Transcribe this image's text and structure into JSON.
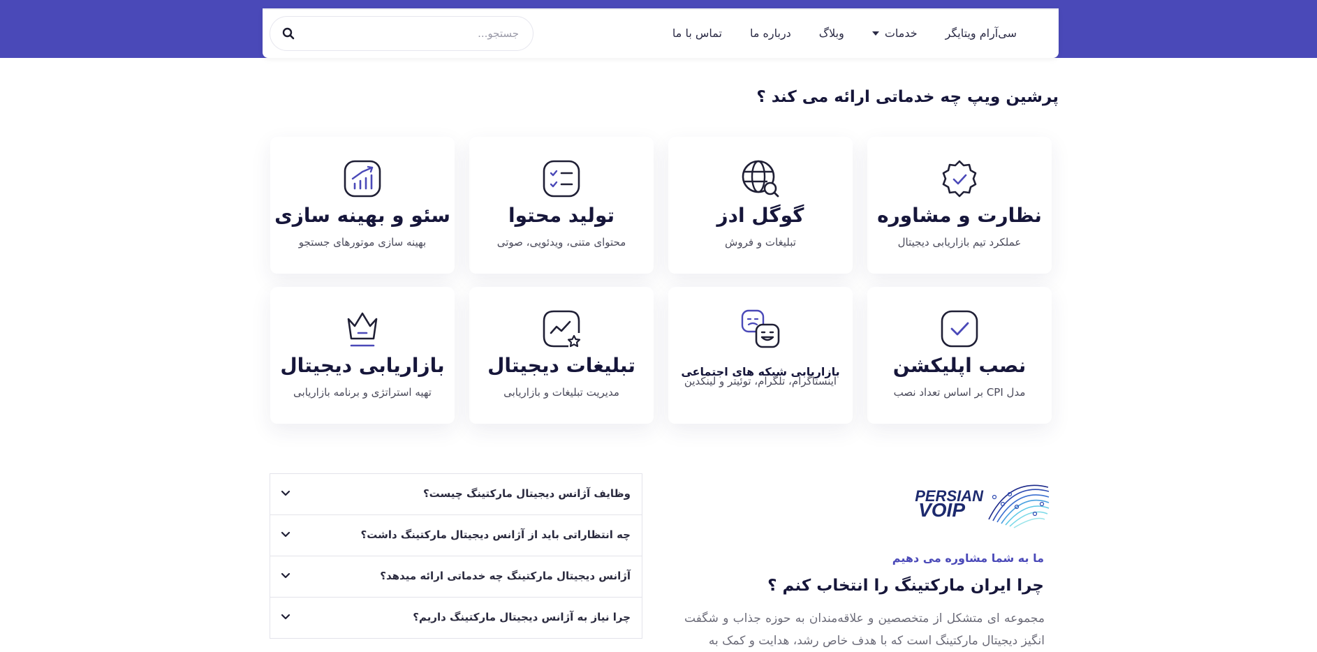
{
  "colors": {
    "brand": "#4a49b8",
    "heading": "#16163a",
    "text": "#4a4a5a"
  },
  "nav": {
    "items": [
      {
        "label": "سی‌آرام ویتایگر",
        "icon": null
      },
      {
        "label": "خدمات",
        "icon": "caret-down-icon"
      },
      {
        "label": "وبلاگ",
        "icon": null
      },
      {
        "label": "درباره ما",
        "icon": null
      },
      {
        "label": "تماس با ما",
        "icon": null
      }
    ],
    "search": {
      "placeholder": "جستجو...",
      "value": "",
      "icon": "search-icon"
    }
  },
  "services": {
    "title": "پرشین ویپ چه خدماتی ارائه می کند ؟",
    "cards": [
      {
        "title": "نظارت و مشاوره",
        "desc": "عملکرد تیم بازاریابی دیجیتال",
        "icon": "badge-check-icon"
      },
      {
        "title": "گوگل ادز",
        "desc": "تبلیغات و فروش",
        "icon": "globe-search-icon"
      },
      {
        "title": "تولید محتوا",
        "desc": "محتوای متنی، ویدئویی، صوتی",
        "icon": "checklist-icon"
      },
      {
        "title": "سئو و بهینه سازی",
        "desc": "بهینه سازی موتورهای جستجو",
        "icon": "growth-chart-icon"
      },
      {
        "title": "نصب اپلیکشن",
        "desc": "مدل CPI بر اساس تعداد نصب",
        "icon": "check-square-icon"
      },
      {
        "title": "بازاریابی شبکه های اجتماعی",
        "desc": "اینستاگرام، تلگرام، توئیتر و لینکدین",
        "icon": "emoji-faces-icon"
      },
      {
        "title": "تبلیغات دیجیتال",
        "desc": "مدیریت تبلیغات و بازاریابی",
        "icon": "chart-star-icon"
      },
      {
        "title": "بازاریابی دیجیتال",
        "desc": "تهیه استراتژی و برنامه بازاریابی",
        "icon": "crown-icon"
      }
    ]
  },
  "faq": {
    "items": [
      "وظایف آژانس دیجیتال مارکتینگ چیست؟",
      "چه انتظاراتی باید از آژانس دیجیتال مارکتینگ داشت؟",
      "آژانس دیجیتال مارکتینگ چه خدماتی ارائه میدهد؟",
      "چرا نیاز به آژانس دیجیتال مارکتینگ داریم؟"
    ]
  },
  "about": {
    "logo": {
      "line1": "PERSIAN",
      "line2": "VOIP"
    },
    "kicker": "ما به شما مشاوره می دهیم",
    "title": "چرا ایران مارکتینگ را انتخاب کنم ؟",
    "paragraph": "مجموعه ای متشکل از متخصصین و علاقه‌مندان به حوزه جذاب و شگفت انگیز دیجیتال مارکتینگ است که با هدف خاص رشد، هدایت و کمک به"
  }
}
